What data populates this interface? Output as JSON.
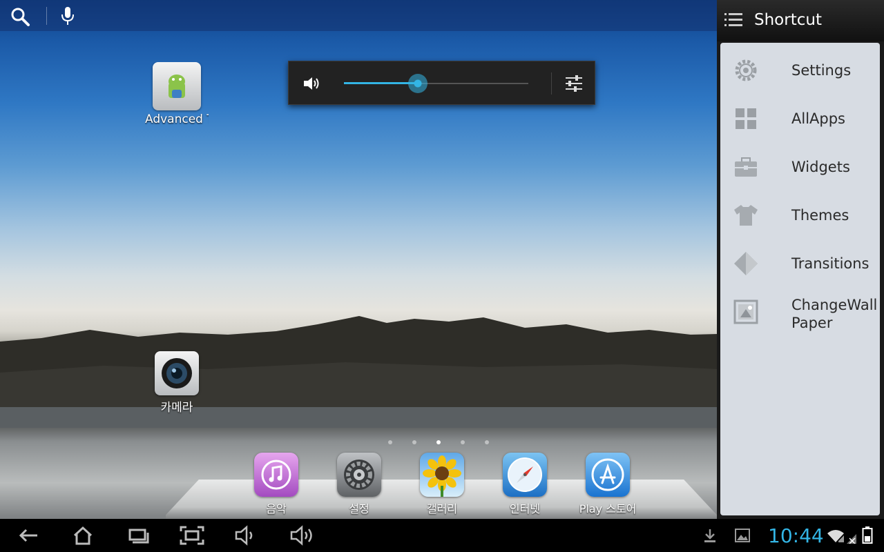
{
  "desktop": {
    "icons": [
      {
        "label": "Advanced T"
      },
      {
        "label": "카메라"
      }
    ]
  },
  "volume": {
    "level_percent": 40
  },
  "pager": {
    "pages": 5,
    "active_index": 2
  },
  "dock": {
    "items": [
      {
        "label": "음악",
        "icon": "music-icon"
      },
      {
        "label": "설정",
        "icon": "settings-gear-icon"
      },
      {
        "label": "갤러리",
        "icon": "sunflower-icon"
      },
      {
        "label": "인터넷",
        "icon": "compass-icon"
      },
      {
        "label": "Play 스토어",
        "icon": "app-store-icon"
      }
    ]
  },
  "shortcut_panel": {
    "title": "Shortcut",
    "items": [
      {
        "label": "Settings",
        "icon": "gear-icon"
      },
      {
        "label": "AllApps",
        "icon": "grid-icon"
      },
      {
        "label": "Widgets",
        "icon": "toolbox-icon"
      },
      {
        "label": "Themes",
        "icon": "shirt-icon"
      },
      {
        "label": "Transitions",
        "icon": "diamond-icon"
      },
      {
        "label": "ChangeWall\nPaper",
        "icon": "wallpaper-icon"
      }
    ]
  },
  "status": {
    "time": "10:44",
    "accent": "#33b5e5"
  }
}
